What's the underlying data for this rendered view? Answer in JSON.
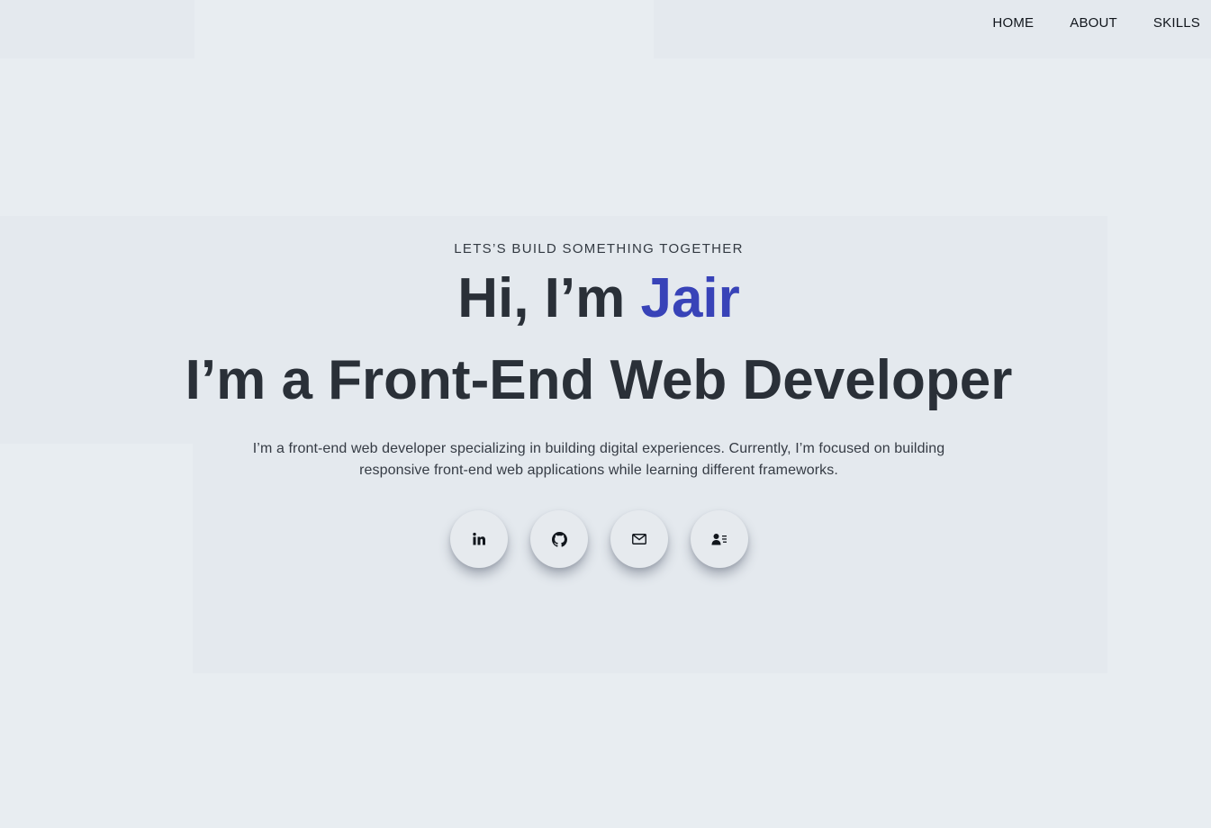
{
  "nav": {
    "items": [
      {
        "label": "HOME"
      },
      {
        "label": "ABOUT"
      },
      {
        "label": "SKILLS"
      }
    ]
  },
  "hero": {
    "tagline": "LETS’S BUILD SOMETHING TOGETHER",
    "greeting_prefix": "Hi, I’m ",
    "name": "Jair",
    "role": "I’m a Front-End Web Developer",
    "description": "I’m a front-end web developer specializing in building digital experiences. Currently, I’m focused on building responsive front-end web applications while learning different frameworks."
  },
  "socials": [
    {
      "icon": "linkedin-icon"
    },
    {
      "icon": "github-icon"
    },
    {
      "icon": "mail-icon"
    },
    {
      "icon": "contact-card-icon"
    }
  ],
  "colors": {
    "background": "#e8edf1",
    "panel": "#e4e9ee",
    "text": "#2a3038",
    "accent": "#3843b8"
  }
}
